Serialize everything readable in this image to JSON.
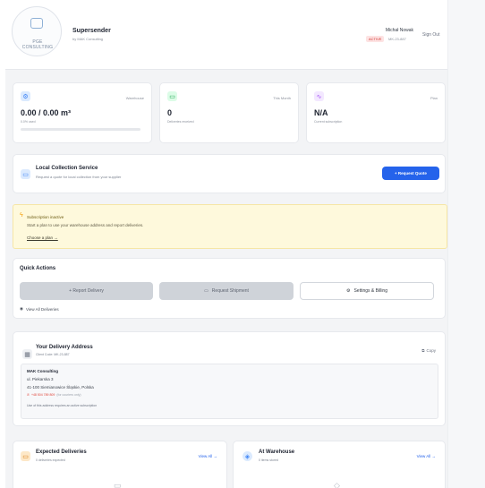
{
  "header": {
    "logo_text": "PGE CONSULTING",
    "app_name": "Supersender",
    "app_sub": "by MAK Consulting",
    "user_name": "Michał Nowak",
    "status_badge": "ACTIVE",
    "user_code": "MK-23-887",
    "sign_out": "Sign Out"
  },
  "stats": [
    {
      "tag": "Warehouse",
      "value": "0.00 / 0.00 m³",
      "sub": "0.0% used",
      "progress_fraction": 0.0,
      "icon": "gear-icon",
      "color": "#3b82f6"
    },
    {
      "tag": "This Month",
      "value": "0",
      "sub": "Deliveries received",
      "icon": "truck-icon",
      "color": "#22c55e"
    },
    {
      "tag": "Plan",
      "value": "N/A",
      "sub": "Current subscription",
      "icon": "activity-icon",
      "color": "#a855f7"
    }
  ],
  "collection": {
    "title": "Local Collection Service",
    "subtitle": "Request a quote for local collection from your supplier",
    "button": "+  Request Quote"
  },
  "alert": {
    "title": "Subscription inactive",
    "body": "Start a plan to use your warehouse address and report deliveries.",
    "link": "Choose a plan →"
  },
  "quick_actions": {
    "title": "Quick Actions",
    "report": "+  Report Delivery",
    "shipment": "Request Shipment",
    "settings": "Settings & Billing",
    "view_all": "View All Deliveries"
  },
  "address": {
    "title": "Your Delivery Address",
    "client_code": "Client Code: MK-23-887",
    "copy": "Copy",
    "company": "MAK Consulting",
    "street": "ul. Piekarska 3",
    "city": "41-100 Siemianowice Śląskie, Polska",
    "phone": "+48 504 789 809",
    "phone_note": "(for couriers only)",
    "note": "Use of this address requires an active subscription"
  },
  "expected": {
    "title": "Expected Deliveries",
    "sub": "0 deliveries expected",
    "view_all": "View All →"
  },
  "warehouse": {
    "title": "At Warehouse",
    "sub": "0 items stored",
    "view_all": "View All →"
  }
}
